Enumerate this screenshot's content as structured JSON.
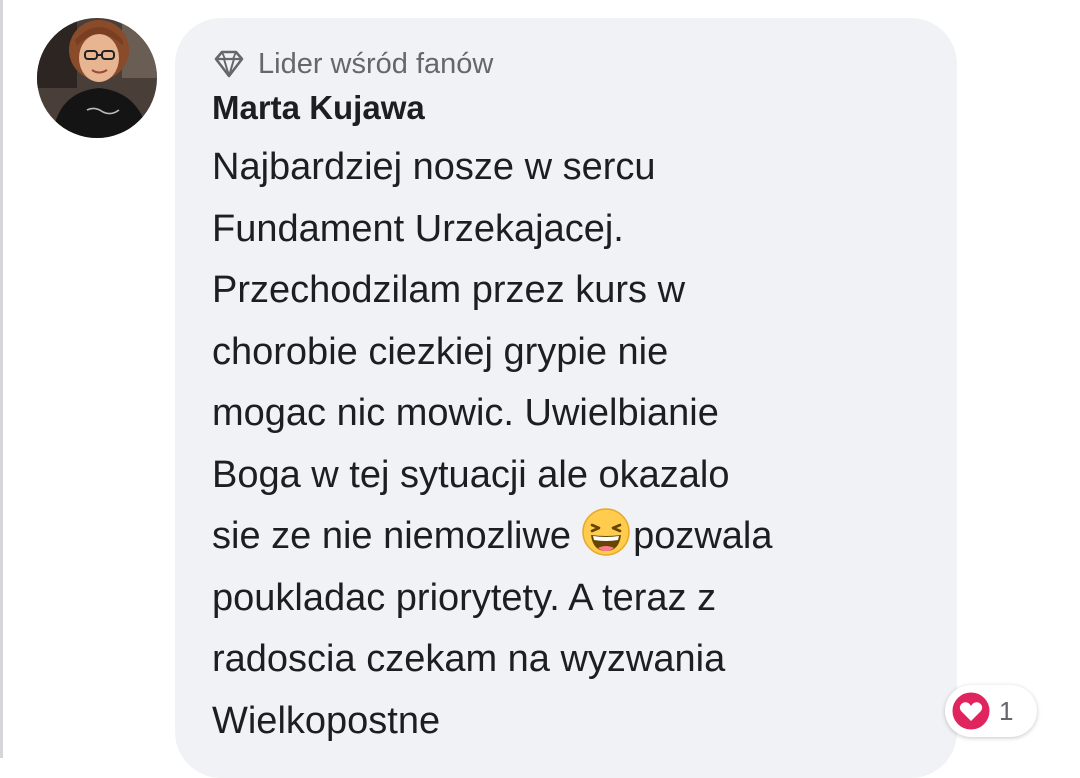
{
  "comment": {
    "badge_label": "Lider wśród fanów",
    "author_name": "Marta Kujawa",
    "lines": [
      "Najbardziej nosze w sercu",
      "Fundament Urzekajacej.",
      "Przechodzilam przez kurs w",
      "chorobie ciezkiej grypie nie",
      "mogac nic mowic. Uwielbianie",
      "Boga w tej sytuacji ale okazalo",
      "sie ze nie niemozliwe",
      "pozwala",
      "poukladac priorytety. A teraz z",
      "radoscia czekam na wyzwania",
      "Wielkopostne"
    ],
    "reaction_count": "1"
  },
  "icons": {
    "badge": "diamond-icon",
    "emoji": "grinning-squinting-face-emoji",
    "reaction": "heart-icon"
  },
  "colors": {
    "bubble_bg": "#f0f2f5",
    "text": "#1c1e21",
    "secondary_text": "#65676b",
    "heart": "#e0245e"
  }
}
